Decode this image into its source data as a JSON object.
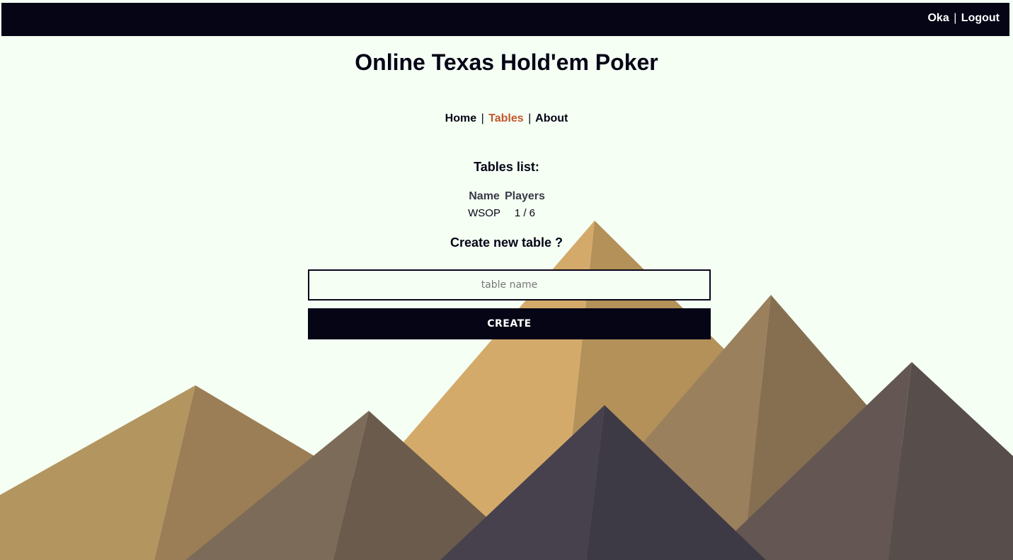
{
  "header": {
    "username": "Oka",
    "separator": "|",
    "logout_label": "Logout"
  },
  "page": {
    "title": "Online Texas Hold'em Poker"
  },
  "nav": {
    "items": [
      {
        "label": "Home",
        "active": false
      },
      {
        "label": "Tables",
        "active": true
      },
      {
        "label": "About",
        "active": false
      }
    ],
    "separator": "|"
  },
  "tables": {
    "title": "Tables list:",
    "columns": [
      "Name",
      "Players"
    ],
    "rows": [
      {
        "name": "WSOP",
        "players": "1 / 6"
      }
    ]
  },
  "create": {
    "title": "Create new table ?",
    "input_placeholder": "table name",
    "input_value": "",
    "button_label": "CREATE"
  },
  "colors": {
    "background": "#f5fff4",
    "dark": "#050516",
    "active_link": "#c5562a",
    "mountain_gold_light": "#d4aa6a",
    "mountain_gold_dark": "#b39159",
    "mountain_brown_light": "#9b805e",
    "mountain_brown_dark": "#866f51",
    "mountain_taupe_light": "#7d6b5a",
    "mountain_taupe_dark": "#6b5b4c",
    "mountain_grey_light": "#645753",
    "mountain_grey_dark": "#574d4b",
    "mountain_slate_light": "#47414d",
    "mountain_slate_dark": "#3e3a45"
  }
}
